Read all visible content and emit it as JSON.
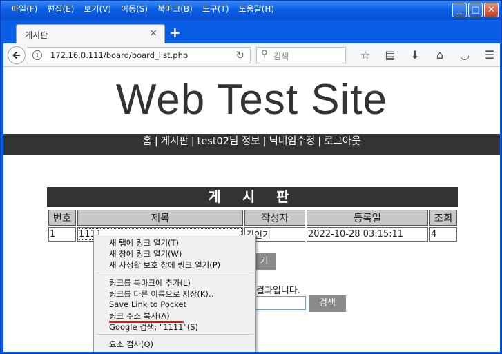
{
  "menubar": [
    "파일(F)",
    "편집(E)",
    "보기(V)",
    "이동(S)",
    "북마크(B)",
    "도구(T)",
    "도움말(H)"
  ],
  "window_buttons": {
    "minimize": "_",
    "maximize": "□",
    "close": "✕"
  },
  "tab": {
    "title": "게시판",
    "close": "×",
    "new_tab": "+"
  },
  "navbar": {
    "url": "172.16.0.111/board/board_list.php",
    "search_placeholder": "검색",
    "icons": [
      "star-icon",
      "reading-list-icon",
      "download-icon",
      "home-icon",
      "pocket-icon",
      "menu-icon"
    ]
  },
  "site": {
    "title": "Web Test Site",
    "nav": [
      "홈",
      "게시판",
      "test02님 정보",
      "닉네임수정",
      "로그아웃"
    ]
  },
  "board": {
    "heading": "게 시 판",
    "columns": [
      "번호",
      "제목",
      "작성자",
      "등록일",
      "조회"
    ],
    "rows": [
      {
        "no": "1",
        "title": "1111",
        "author": "김인기",
        "date": "2022-10-28 03:15:11",
        "views": "4"
      }
    ],
    "write_button_partial": "기",
    "result_text_partial": "결과입니다.",
    "search_button": "검색"
  },
  "context_menu": {
    "items": [
      "새 탭에 링크 열기(T)",
      "새 창에 링크 열기(W)",
      "새 사생활 보호 창에 링크 열기(P)",
      "링크를 북마크에 추가(L)",
      "링크를 다른 이름으로 저장(K)…",
      "Save Link to Pocket",
      "링크 주소 복사(A)",
      "Google 검색: \"1111\"(S)",
      "요소 검사(Q)"
    ],
    "highlight_color": "#dd1111"
  },
  "colors": {
    "titlebar": "#0a5ee6",
    "site_nav_bg": "#333333",
    "header_cell_bg": "#c8c8c8",
    "button_gray": "#8a8a8a"
  }
}
